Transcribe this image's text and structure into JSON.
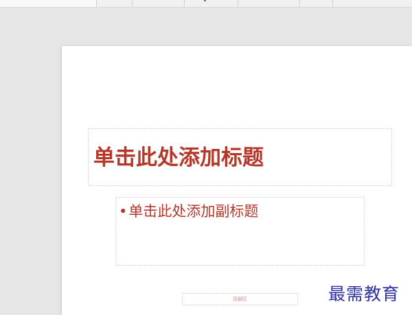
{
  "slide": {
    "title_placeholder": "单击此处添加标题",
    "subtitle_bullet": "•",
    "subtitle_placeholder": "单击此处添加副标题",
    "footer_placeholder": "页脚区"
  },
  "watermark": {
    "text": "最需教育"
  },
  "colors": {
    "title": "#b5372a",
    "watermark": "#2b2fa0",
    "canvas": "#e6e6e6",
    "slide": "#ffffff"
  }
}
